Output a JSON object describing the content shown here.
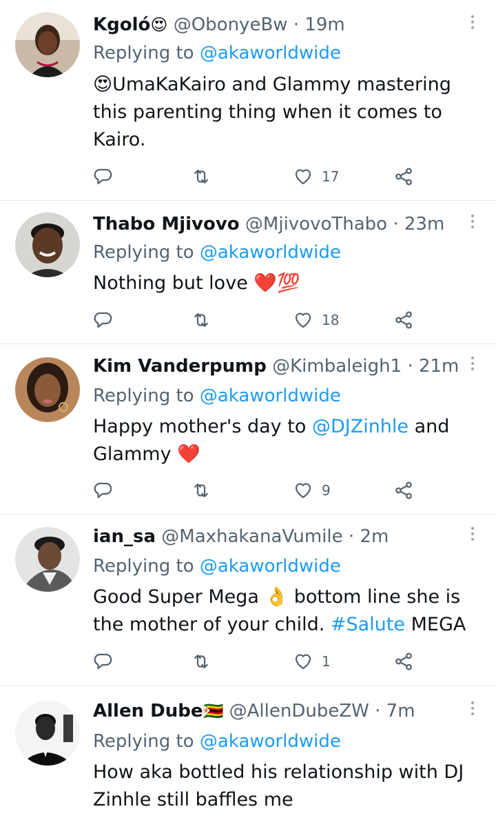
{
  "tweets": [
    {
      "name": "Kgoló",
      "name_emoji": "😍",
      "handle": "@ObonyeBw",
      "time": "19m",
      "replying_prefix": "Replying to ",
      "replying_to": "@akaworldwide",
      "text_parts": [
        "😍UmaKaKairo and Glammy mastering this parenting thing when it comes to Kairo."
      ],
      "likes": "17"
    },
    {
      "name": "Thabo Mjivovo",
      "name_emoji": "",
      "handle": "@MjivovoThabo",
      "time": "23m",
      "replying_prefix": "Replying to ",
      "replying_to": "@akaworldwide",
      "text_parts": [
        "Nothing but love ",
        "❤️",
        "💯"
      ],
      "likes": "18"
    },
    {
      "name": "Kim Vanderpump",
      "name_emoji": "",
      "handle": "@Kimbaleigh1",
      "time": "21m",
      "replying_prefix": "Replying to ",
      "replying_to": "@akaworldwide",
      "text_parts": [
        "Happy mother's day to ",
        "@DJZinhle",
        " and Glammy ",
        "❤️"
      ],
      "likes": "9"
    },
    {
      "name": "ian_sa",
      "name_emoji": "",
      "handle": "@MaxhakanaVumile",
      "time": "2m",
      "replying_prefix": "Replying to ",
      "replying_to": "@akaworldwide",
      "text_parts": [
        "Good Super Mega ",
        "👌",
        " bottom line she is the mother of your child. ",
        "#Salute",
        " MEGA"
      ],
      "likes": "1"
    },
    {
      "name": "Allen Dube",
      "name_emoji": "🇿🇼",
      "handle": "@AllenDubeZW",
      "time": "7m",
      "replying_prefix": "Replying to ",
      "replying_to": "@akaworldwide",
      "text_parts": [
        "How aka bottled his relationship with DJ Zinhle still baffles me"
      ],
      "likes": ""
    }
  ],
  "separator": " · ",
  "icons": {
    "reply": "reply-icon",
    "retweet": "retweet-icon",
    "like": "heart-icon",
    "share": "share-icon",
    "more": "more-vertical-icon"
  },
  "colors": {
    "link": "#1d9bf0",
    "meta": "#536471",
    "heart_emoji": "#d0021b"
  }
}
